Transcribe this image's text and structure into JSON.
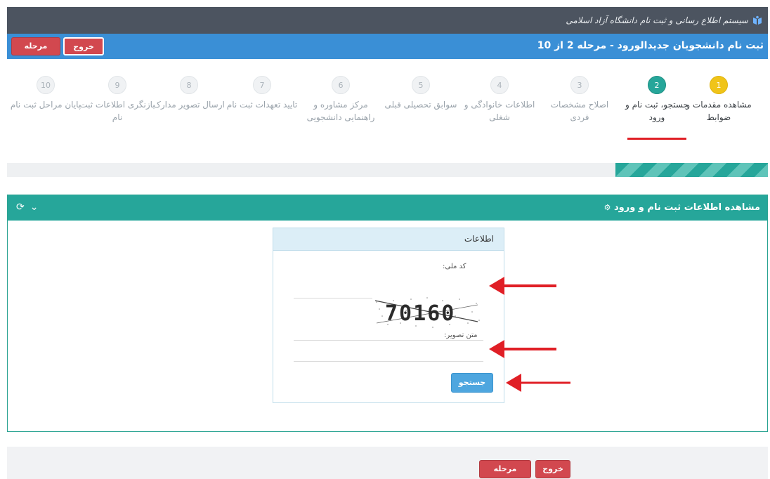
{
  "header": {
    "brand_text": "سیستم اطلاع رسانی و ثبت نام دانشگاه آزاد اسلامی",
    "step_title": "ثبت نام دانشجویان جدیدالورود - مرحله 2 از 10",
    "exit_label": "خروج",
    "prev_label": "مرحله قبل"
  },
  "steps": [
    {
      "num": "1",
      "label": "مشاهده مقدمات و ضوابط",
      "state": "done"
    },
    {
      "num": "2",
      "label": "جستجو، ثبت نام و ورود",
      "state": "active"
    },
    {
      "num": "3",
      "label": "اصلاح مشخصات فردی",
      "state": "pending"
    },
    {
      "num": "4",
      "label": "اطلاعات خانوادگی و شغلی",
      "state": "pending"
    },
    {
      "num": "5",
      "label": "سوابق تحصیلی قبلی",
      "state": "pending"
    },
    {
      "num": "6",
      "label": "مرکز مشاوره و راهنمایی دانشجویی",
      "state": "pending"
    },
    {
      "num": "7",
      "label": "تایید تعهدات ثبت نام",
      "state": "pending"
    },
    {
      "num": "8",
      "label": "ارسال تصویر مدارک",
      "state": "pending"
    },
    {
      "num": "9",
      "label": "بازنگری اطلاعات ثبت نام",
      "state": "pending"
    },
    {
      "num": "10",
      "label": "پایان مراحل ثبت نام",
      "state": "pending"
    }
  ],
  "progress": {
    "fraction": 0.2
  },
  "panel": {
    "title": "مشاهده اطلاعات ثبت نام و ورود",
    "refresh_icon": "⟳",
    "collapse_icon": "⌄"
  },
  "form": {
    "card_title": "اطلاعات",
    "national_code_label": "کد ملی:",
    "captcha_text": "70160",
    "captcha_label": "متن تصویر:",
    "search_label": "جستجو"
  },
  "footer": {
    "exit_label": "خروج",
    "prev_label": "مرحله قبل"
  },
  "colors": {
    "teal": "#26a69a",
    "blue": "#3a8fd6",
    "red": "#d2484f",
    "arrow": "#e01f26"
  }
}
